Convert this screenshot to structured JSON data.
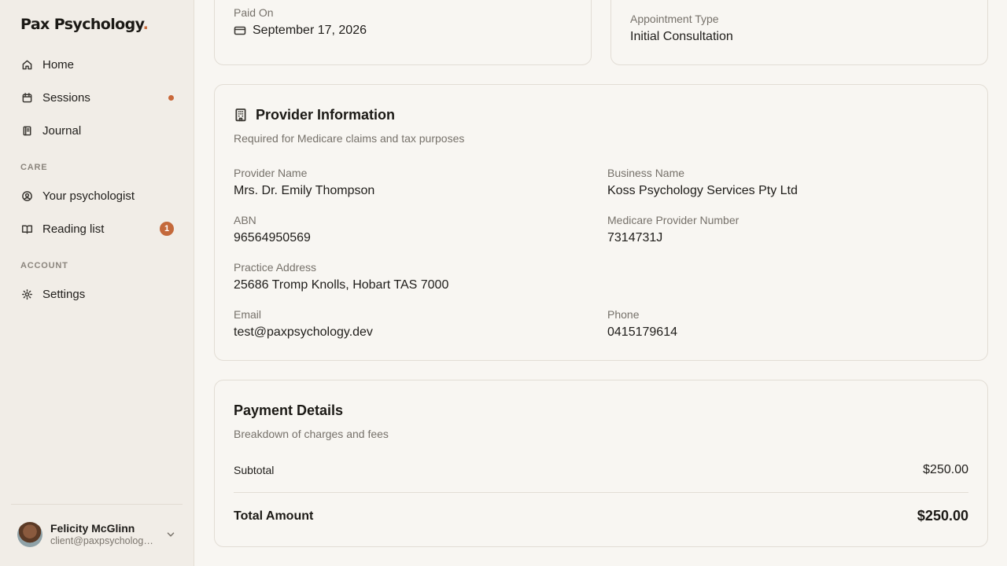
{
  "brand": {
    "name": "Pax Psychology",
    "dot": "."
  },
  "sidebar": {
    "nav": [
      {
        "label": "Home",
        "icon": "home-icon"
      },
      {
        "label": "Sessions",
        "icon": "calendar-icon",
        "indicator": "dot"
      },
      {
        "label": "Journal",
        "icon": "notebook-icon"
      }
    ],
    "care_label": "CARE",
    "care": [
      {
        "label": "Your psychologist",
        "icon": "user-circle-icon"
      },
      {
        "label": "Reading list",
        "icon": "book-open-icon",
        "badge": "1"
      }
    ],
    "account_label": "ACCOUNT",
    "account": [
      {
        "label": "Settings",
        "icon": "gear-icon"
      }
    ],
    "user": {
      "name": "Felicity McGlinn",
      "email": "client@paxpsychology.dev",
      "chevron": "chevron-down-icon"
    }
  },
  "paid_card": {
    "label": "Paid On",
    "value": "September 17, 2026",
    "icon": "credit-card-icon"
  },
  "appointment_card": {
    "label": "Appointment Type",
    "value": "Initial Consultation"
  },
  "provider": {
    "title": "Provider Information",
    "icon": "building-icon",
    "subtitle": "Required for Medicare claims and tax purposes",
    "fields": {
      "provider_name": {
        "label": "Provider Name",
        "value": "Mrs. Dr. Emily Thompson"
      },
      "business_name": {
        "label": "Business Name",
        "value": "Koss Psychology Services Pty Ltd"
      },
      "abn": {
        "label": "ABN",
        "value": "96564950569"
      },
      "medicare": {
        "label": "Medicare Provider Number",
        "value": "7314731J"
      },
      "address": {
        "label": "Practice Address",
        "value": "25686 Tromp Knolls, Hobart TAS 7000"
      },
      "email": {
        "label": "Email",
        "value": "test@paxpsychology.dev"
      },
      "phone": {
        "label": "Phone",
        "value": "0415179614"
      }
    }
  },
  "payment": {
    "title": "Payment Details",
    "subtitle": "Breakdown of charges and fees",
    "subtotal_label": "Subtotal",
    "subtotal_value": "$250.00",
    "total_label": "Total Amount",
    "total_value": "$250.00"
  },
  "colors": {
    "accent": "#c96a3a",
    "background": "#f8f6f2",
    "sidebar": "#f1ede7",
    "border": "#e2ddd5"
  }
}
